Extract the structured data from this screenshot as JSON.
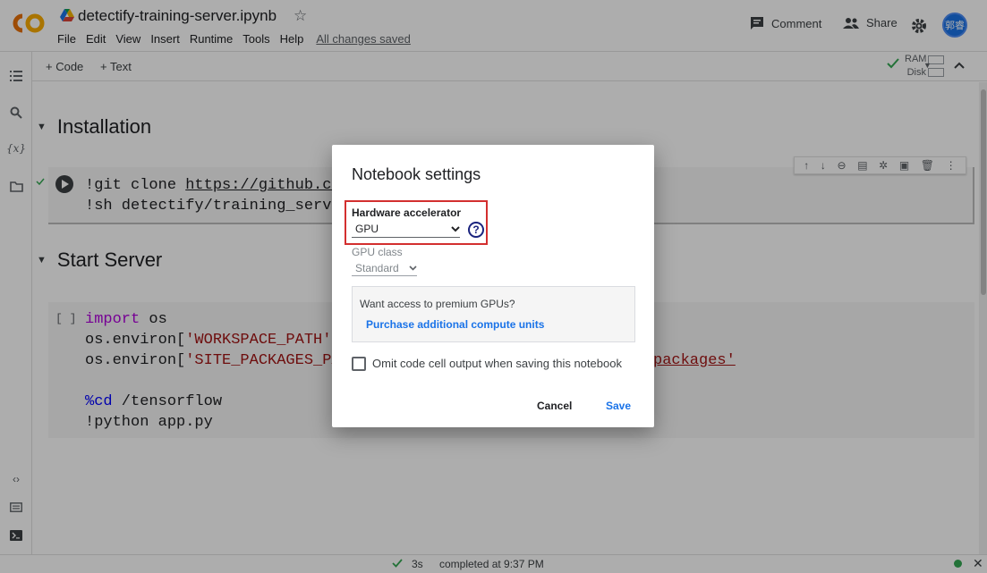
{
  "header": {
    "title": "detectify-training-server.ipynb",
    "menu": [
      "File",
      "Edit",
      "View",
      "Insert",
      "Runtime",
      "Tools",
      "Help"
    ],
    "saved_status": "All changes saved",
    "comment_label": "Comment",
    "share_label": "Share",
    "avatar_text": "郭睿"
  },
  "toolbar": {
    "add_code": "+ Code",
    "add_text": "+ Text",
    "ram_label": "RAM",
    "disk_label": "Disk"
  },
  "notebook": {
    "section1": "Installation",
    "cell1_line1_prefix": "!git clone ",
    "cell1_line1_url": "https://github.co",
    "cell1_line2": "!sh detectify/training_serve",
    "section2": "Start Server",
    "cell2_bracket": "[ ]",
    "cell2_import_kw": "import",
    "cell2_import_rest": " os",
    "cell2_line2_prefix": "os.environ[",
    "cell2_line2_str": "'WORKSPACE_PATH'",
    "cell2_line2_suffix": "]",
    "cell2_line3_prefix": "os.environ[",
    "cell2_line3_str": "'SITE_PACKAGES_PA",
    "cell2_line3_tail": "packages'",
    "cell2_line5_magic": "%cd",
    "cell2_line5_rest": " /tensorflow",
    "cell2_line6": "!python app.py"
  },
  "status": {
    "duration": "3s",
    "completed": "completed at 9:37 PM"
  },
  "dialog": {
    "title": "Notebook settings",
    "hw_label": "Hardware accelerator",
    "hw_value": "GPU",
    "help_glyph": "?",
    "gpu_class_label": "GPU class",
    "gpu_class_value": "Standard",
    "premium_question": "Want access to premium GPUs?",
    "premium_link": "Purchase additional compute units",
    "omit_label": "Omit code cell output when saving this notebook",
    "cancel": "Cancel",
    "save": "Save"
  },
  "colors": {
    "highlight": "#d32f2f",
    "accent": "#1a73e8",
    "overlay": "rgba(0,0,0,0.32)"
  }
}
